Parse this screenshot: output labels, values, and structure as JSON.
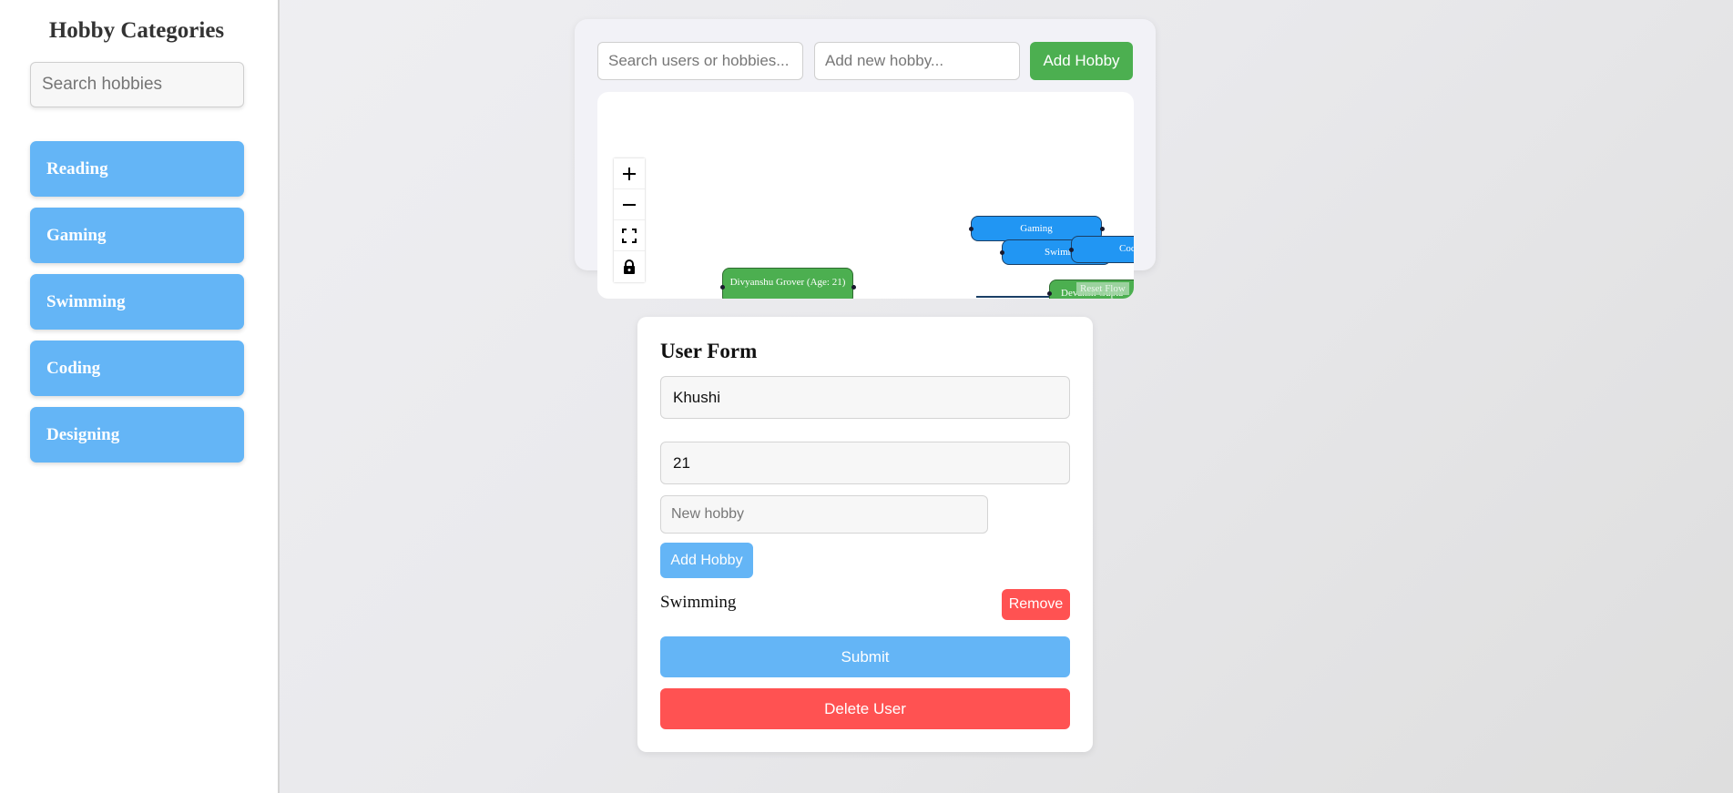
{
  "sidebar": {
    "title": "Hobby Categories",
    "search_placeholder": "Search hobbies",
    "items": [
      {
        "label": "Reading"
      },
      {
        "label": "Gaming"
      },
      {
        "label": "Swimming"
      },
      {
        "label": "Coding"
      },
      {
        "label": "Designing"
      }
    ]
  },
  "toolbar": {
    "search_placeholder": "Search users or hobbies...",
    "new_hobby_placeholder": "Add new hobby...",
    "add_label": "Add Hobby"
  },
  "flow": {
    "controls": [
      "zoom-in-icon",
      "zoom-out-icon",
      "fit-view-icon",
      "lock-icon"
    ],
    "nodes": {
      "gaming": "Gaming",
      "swimming": "Swimming",
      "coding": "Coding",
      "user1": "Divyanshu Grover (Age: 21)",
      "user2": "Devansh Gupta"
    },
    "reset_label": "Reset Flow"
  },
  "form": {
    "title": "User Form",
    "name_value": "Khushi",
    "age_value": "21",
    "hobby_placeholder": "New hobby",
    "add_label": "Add Hobby",
    "hobbies": [
      {
        "name": "Swimming",
        "remove_label": "Remove"
      }
    ],
    "submit_label": "Submit",
    "delete_label": "Delete User"
  },
  "colors": {
    "accent_blue": "#64b5f6",
    "node_blue": "#2196f3",
    "green": "#4caf50",
    "danger": "#ff5252"
  }
}
